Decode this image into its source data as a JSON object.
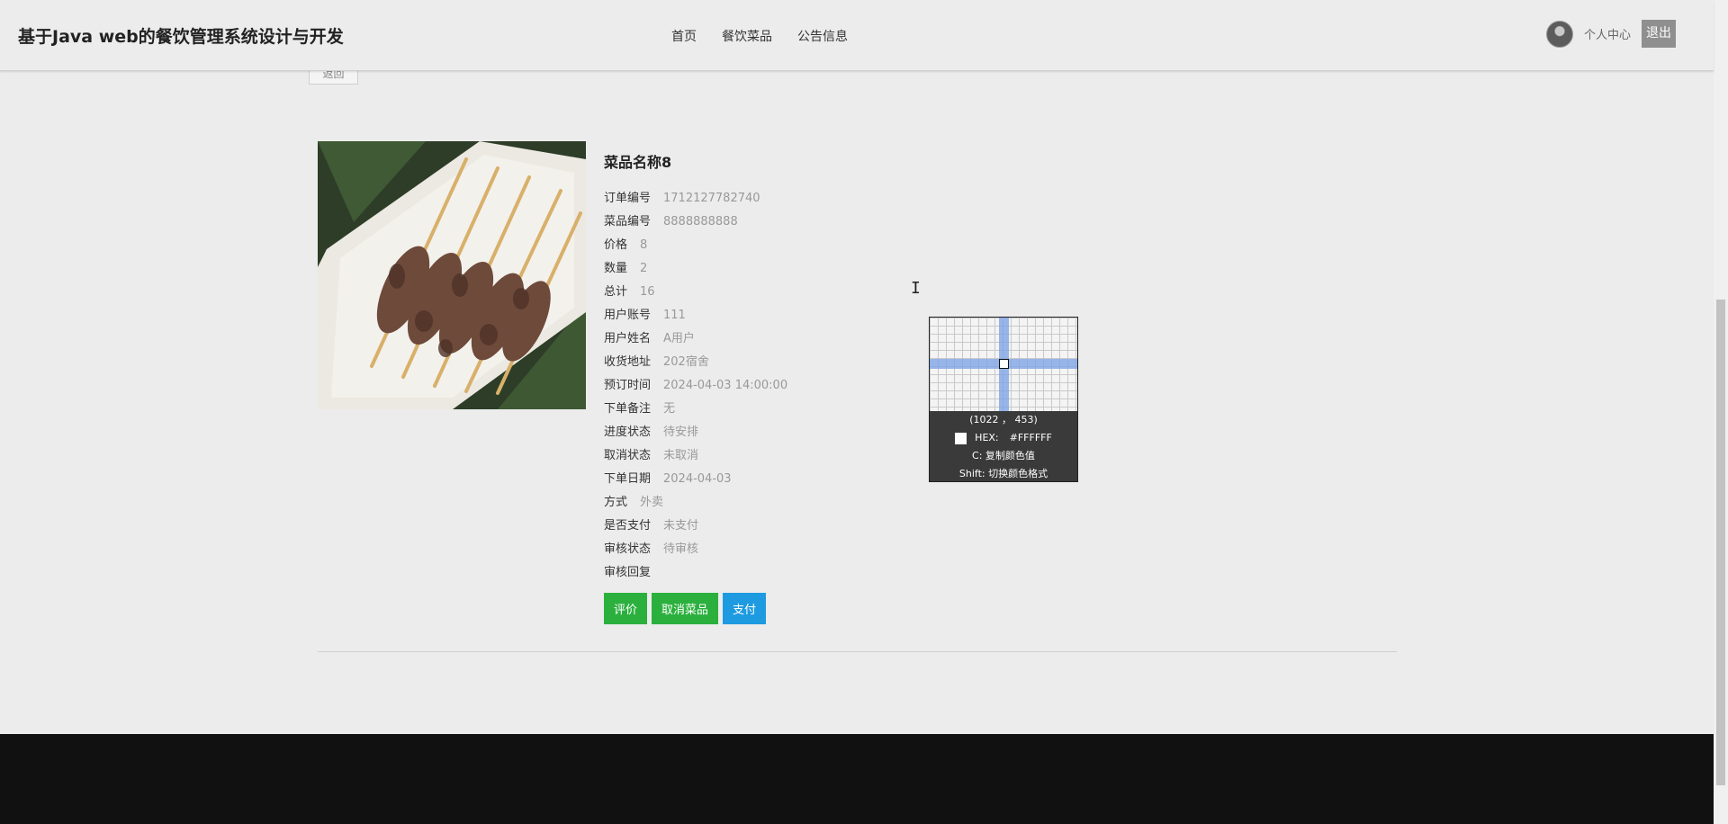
{
  "header": {
    "title": "基于Java web的餐饮管理系统设计与开发",
    "nav": [
      {
        "label": "首页"
      },
      {
        "label": "餐饮菜品"
      },
      {
        "label": "公告信息"
      }
    ],
    "profile_label": "个人中心",
    "logout_label": "退出"
  },
  "back_label": "返回",
  "dish": {
    "name": "菜品名称8",
    "fields": [
      {
        "label": "订单编号",
        "value": "1712127782740"
      },
      {
        "label": "菜品编号",
        "value": "8888888888"
      },
      {
        "label": "价格",
        "value": "8"
      },
      {
        "label": "数量",
        "value": "2"
      },
      {
        "label": "总计",
        "value": "16"
      },
      {
        "label": "用户账号",
        "value": "111"
      },
      {
        "label": "用户姓名",
        "value": "A用户"
      },
      {
        "label": "收货地址",
        "value": "202宿舍"
      },
      {
        "label": "预订时间",
        "value": "2024-04-03 14:00:00"
      },
      {
        "label": "下单备注",
        "value": "无"
      },
      {
        "label": "进度状态",
        "value": "待安排"
      },
      {
        "label": "取消状态",
        "value": "未取消"
      },
      {
        "label": "下单日期",
        "value": "2024-04-03"
      },
      {
        "label": "方式",
        "value": "外卖"
      },
      {
        "label": "是否支付",
        "value": "未支付"
      },
      {
        "label": "审核状态",
        "value": "待审核"
      },
      {
        "label": "审核回复",
        "value": ""
      }
    ]
  },
  "actions": {
    "review": "评价",
    "cancel": "取消菜品",
    "pay": "支付"
  },
  "picker": {
    "coords": "(1022 ， 453)",
    "hex_label": "HEX:",
    "hex_value": "#FFFFFF",
    "copy_hint": "C: 复制颜色值",
    "shift_hint": "Shift: 切换颜色格式"
  },
  "colors": {
    "green_button": "#2bb03e",
    "blue_button": "#1e9be0",
    "footer": "#111111",
    "background": "#ececec"
  }
}
